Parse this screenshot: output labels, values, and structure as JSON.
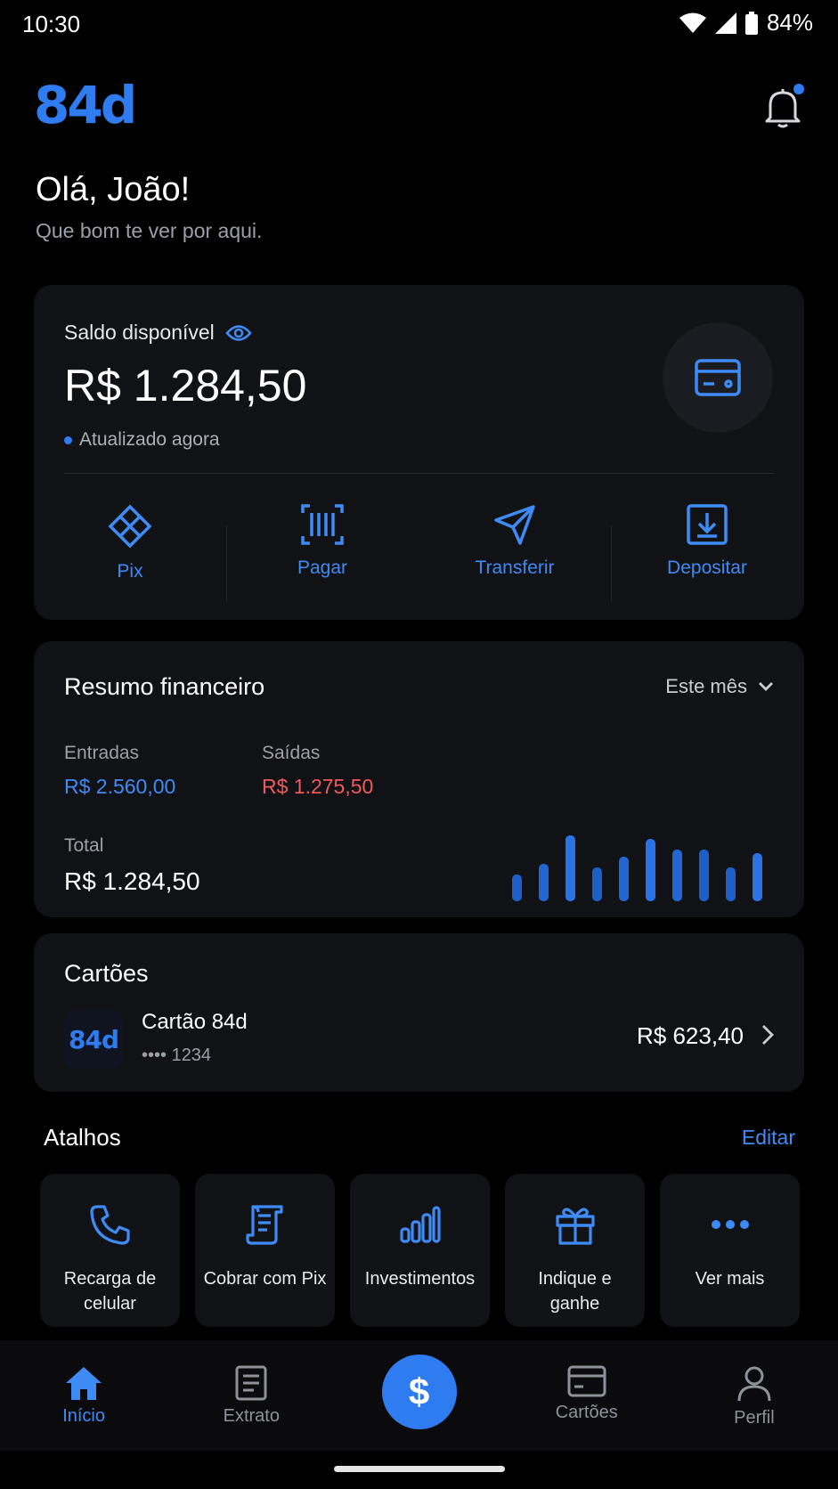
{
  "status_bar": {
    "time": "10:30",
    "battery": "84%"
  },
  "header": {
    "logo": "84d"
  },
  "greeting": {
    "title": "Olá, João!",
    "subtitle": "Que bom te ver por aqui."
  },
  "balance": {
    "label": "Saldo disponível",
    "value": "R$ 1.284,50",
    "updated": "Atualizado agora",
    "actions": [
      {
        "label": "Pix",
        "icon": "pix-icon"
      },
      {
        "label": "Pagar",
        "icon": "barcode-icon"
      },
      {
        "label": "Transferir",
        "icon": "send-icon"
      },
      {
        "label": "Depositar",
        "icon": "deposit-icon"
      }
    ]
  },
  "summary": {
    "title": "Resumo financeiro",
    "filter": "Este mês",
    "income_label": "Entradas",
    "income_value": "R$ 2.560,00",
    "expense_label": "Saídas",
    "expense_value": "R$ 1.275,50",
    "total_label": "Total",
    "total_value": "R$ 1.284,50"
  },
  "cards": {
    "title": "Cartões",
    "item": {
      "logo": "84d",
      "name": "Cartão 84d",
      "number": "•••• 1234",
      "amount": "R$ 623,40"
    }
  },
  "shortcuts": {
    "title": "Atalhos",
    "edit": "Editar",
    "items": [
      {
        "label": "Recarga de celular",
        "icon": "phone-icon"
      },
      {
        "label": "Cobrar com Pix",
        "icon": "receipt-icon"
      },
      {
        "label": "Investimentos",
        "icon": "bar-chart-icon"
      },
      {
        "label": "Indique e ganhe",
        "icon": "gift-icon"
      },
      {
        "label": "Ver mais",
        "icon": "more-icon"
      }
    ]
  },
  "bottom_nav": {
    "items": [
      {
        "label": "Início",
        "icon": "home-icon",
        "active": true
      },
      {
        "label": "Extrato",
        "icon": "statement-icon"
      },
      {
        "label": "",
        "icon": "dollar-icon"
      },
      {
        "label": "Cartões",
        "icon": "card-icon"
      },
      {
        "label": "Perfil",
        "icon": "profile-icon"
      }
    ],
    "fab_symbol": "$"
  },
  "colors": {
    "accent": "#2f7bf0",
    "expense": "#f05a5a",
    "background": "#000000",
    "card": "#111216"
  }
}
